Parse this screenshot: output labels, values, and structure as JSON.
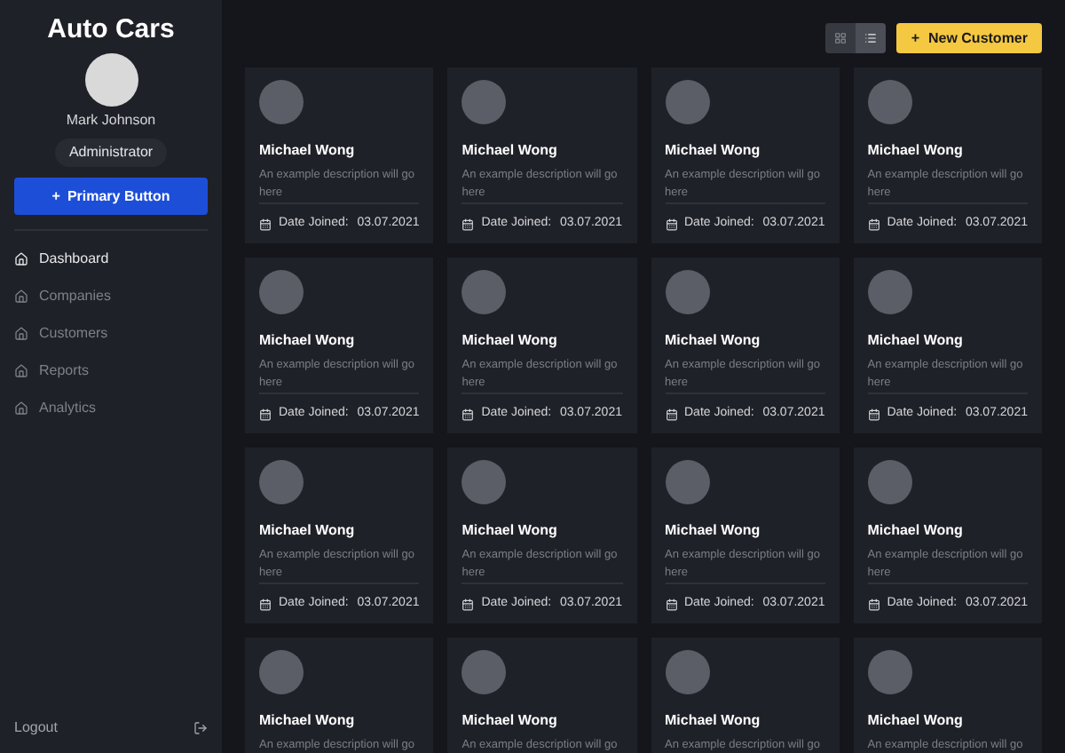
{
  "sidebar": {
    "title": "Auto Cars",
    "user": {
      "name": "Mark Johnson",
      "role": "Administrator"
    },
    "primary_button": {
      "icon": "+",
      "label": "Primary Button"
    },
    "items": [
      {
        "label": "Dashboard",
        "selected": true
      },
      {
        "label": "Companies",
        "selected": false
      },
      {
        "label": "Customers",
        "selected": false
      },
      {
        "label": "Reports",
        "selected": false
      },
      {
        "label": "Analytics",
        "selected": false
      }
    ],
    "logout": "Logout"
  },
  "toolbar": {
    "views": [
      {
        "kind": "grid",
        "selected": false
      },
      {
        "kind": "list",
        "selected": true
      }
    ],
    "new_button": {
      "icon": "+",
      "label": "New Customer"
    }
  },
  "cards": [
    {
      "name": "Michael Wong",
      "description": "An example description will go here",
      "date_label": "Date Joined:",
      "date": "03.07.2021"
    },
    {
      "name": "Michael Wong",
      "description": "An example description will go here",
      "date_label": "Date Joined:",
      "date": "03.07.2021"
    },
    {
      "name": "Michael Wong",
      "description": "An example description will go here",
      "date_label": "Date Joined:",
      "date": "03.07.2021"
    },
    {
      "name": "Michael Wong",
      "description": "An example description will go here",
      "date_label": "Date Joined:",
      "date": "03.07.2021"
    },
    {
      "name": "Michael Wong",
      "description": "An example description will go here",
      "date_label": "Date Joined:",
      "date": "03.07.2021"
    },
    {
      "name": "Michael Wong",
      "description": "An example description will go here",
      "date_label": "Date Joined:",
      "date": "03.07.2021"
    },
    {
      "name": "Michael Wong",
      "description": "An example description will go here",
      "date_label": "Date Joined:",
      "date": "03.07.2021"
    },
    {
      "name": "Michael Wong",
      "description": "An example description will go here",
      "date_label": "Date Joined:",
      "date": "03.07.2021"
    },
    {
      "name": "Michael Wong",
      "description": "An example description will go here",
      "date_label": "Date Joined:",
      "date": "03.07.2021"
    },
    {
      "name": "Michael Wong",
      "description": "An example description will go here",
      "date_label": "Date Joined:",
      "date": "03.07.2021"
    },
    {
      "name": "Michael Wong",
      "description": "An example description will go here",
      "date_label": "Date Joined:",
      "date": "03.07.2021"
    },
    {
      "name": "Michael Wong",
      "description": "An example description will go here",
      "date_label": "Date Joined:",
      "date": "03.07.2021"
    },
    {
      "name": "Michael Wong",
      "description": "An example description will go"
    },
    {
      "name": "Michael Wong",
      "description": "An example description will go"
    },
    {
      "name": "Michael Wong",
      "description": "An example description will go"
    },
    {
      "name": "Michael Wong",
      "description": "An example description will go"
    }
  ]
}
